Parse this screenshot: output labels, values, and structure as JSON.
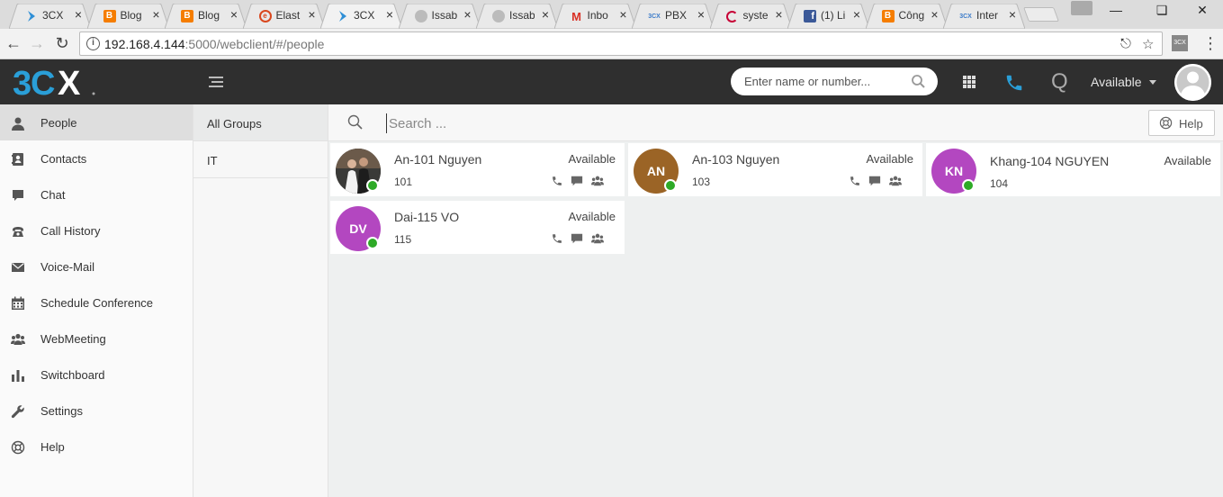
{
  "browser": {
    "tabs": [
      {
        "title": "3CX",
        "favicon": "3cx-chevron-icon",
        "color": "#2f8fd6"
      },
      {
        "title": "Blog",
        "favicon": "blogger-icon",
        "color": "#f57d00"
      },
      {
        "title": "Blog",
        "favicon": "blogger-icon",
        "color": "#f57d00"
      },
      {
        "title": "Elast",
        "favicon": "elastix-icon",
        "color": "#d9471e"
      },
      {
        "title": "3CX",
        "favicon": "3cx-chevron-icon",
        "color": "#2f8fd6"
      },
      {
        "title": "Issab",
        "favicon": "globe-icon",
        "color": "#bbbbbb"
      },
      {
        "title": "Issab",
        "favicon": "globe-icon",
        "color": "#bbbbbb"
      },
      {
        "title": "Inbo",
        "favicon": "gmail-icon",
        "color": "#d93025"
      },
      {
        "title": "PBX",
        "favicon": "3cx-small-icon",
        "color": "#3d7cc9"
      },
      {
        "title": "syste",
        "favicon": "debian-icon",
        "color": "#c70036"
      },
      {
        "title": "(1) Li",
        "favicon": "facebook-icon",
        "color": "#3b5998"
      },
      {
        "title": "Công",
        "favicon": "blogger-icon",
        "color": "#f57d00"
      },
      {
        "title": "Inter",
        "favicon": "3cx-small-icon",
        "color": "#3d7cc9"
      }
    ],
    "active_tab_index": 4,
    "url_host": "192.168.4.144",
    "url_rest": ":5000/webclient/#/people"
  },
  "header": {
    "logo_text": "3CX",
    "search_placeholder": "Enter name or number...",
    "q_label": "Q",
    "status": "Available"
  },
  "sidebar": {
    "items": [
      {
        "label": "People",
        "icon": "person-icon",
        "active": true
      },
      {
        "label": "Contacts",
        "icon": "contacts-icon",
        "active": false
      },
      {
        "label": "Chat",
        "icon": "chat-bubble-icon",
        "active": false
      },
      {
        "label": "Call History",
        "icon": "telephone-icon",
        "active": false
      },
      {
        "label": "Voice-Mail",
        "icon": "envelope-icon",
        "active": false
      },
      {
        "label": "Schedule Conference",
        "icon": "calendar-icon",
        "active": false
      },
      {
        "label": "WebMeeting",
        "icon": "group-icon",
        "active": false
      },
      {
        "label": "Switchboard",
        "icon": "bar-chart-icon",
        "active": false
      },
      {
        "label": "Settings",
        "icon": "wrench-icon",
        "active": false
      },
      {
        "label": "Help",
        "icon": "lifebuoy-icon",
        "active": false
      }
    ]
  },
  "groups": {
    "items": [
      {
        "label": "All Groups",
        "active": true
      },
      {
        "label": "IT",
        "active": false
      }
    ]
  },
  "main": {
    "search_placeholder": "Search ...",
    "help_label": "Help"
  },
  "people": [
    {
      "name": "An-101 Nguyen",
      "ext": "101",
      "status": "Available",
      "initials": "",
      "avatar": "photo",
      "color": "#4a3a30",
      "actions": true
    },
    {
      "name": "An-103 Nguyen",
      "ext": "103",
      "status": "Available",
      "initials": "AN",
      "avatar": "initials",
      "color": "#9b6426",
      "actions": true
    },
    {
      "name": "Khang-104 NGUYEN",
      "ext": "104",
      "status": "Available",
      "initials": "KN",
      "avatar": "initials",
      "color": "#b347c0",
      "actions": false
    },
    {
      "name": "Dai-115 VO",
      "ext": "115",
      "status": "Available",
      "initials": "DV",
      "avatar": "initials",
      "color": "#b347c0",
      "actions": true
    }
  ],
  "colors": {
    "header_bg": "#2f2f2f",
    "logo_blue": "#2a9fd8",
    "online_green": "#2eaa27",
    "phone_blue": "#2a9fd8"
  }
}
